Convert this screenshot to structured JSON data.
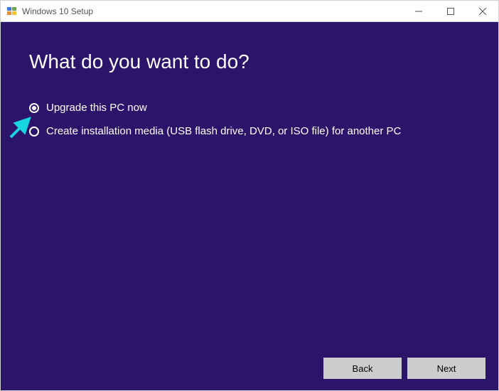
{
  "titlebar": {
    "title": "Windows 10 Setup"
  },
  "heading": "What do you want to do?",
  "options": [
    {
      "label": "Upgrade this PC now",
      "selected": true
    },
    {
      "label": "Create installation media (USB flash drive, DVD, or ISO file) for another PC",
      "selected": false
    }
  ],
  "buttons": {
    "back": "Back",
    "next": "Next"
  }
}
